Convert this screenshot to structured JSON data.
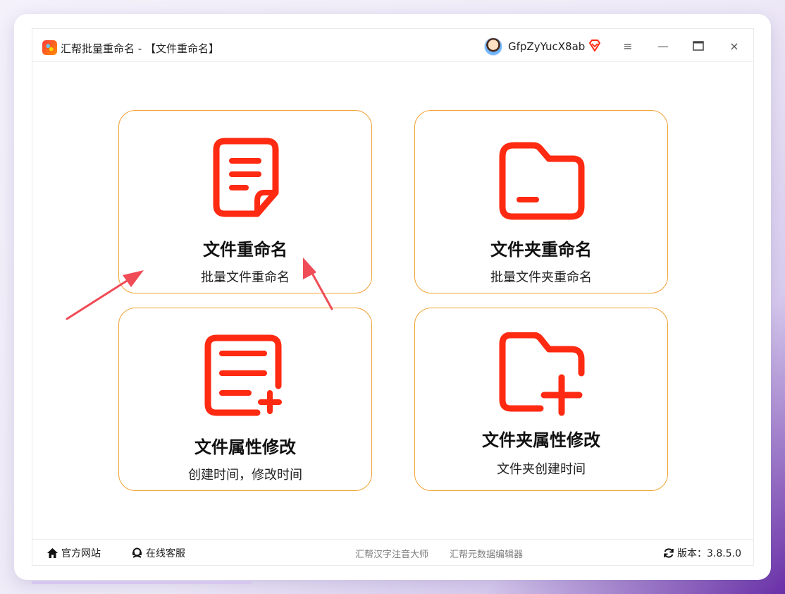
{
  "window": {
    "title": "汇帮批量重命名 - 【文件重命名】",
    "username": "GfpZyYucX8ab",
    "controls": {
      "menu": "≡",
      "minimize": "—",
      "maximize": "□",
      "close": "×"
    }
  },
  "cards": [
    {
      "title": "文件重命名",
      "subtitle": "批量文件重命名",
      "icon": "document-icon"
    },
    {
      "title": "文件夹重命名",
      "subtitle": "批量文件夹重命名",
      "icon": "folder-icon"
    },
    {
      "title": "文件属性修改",
      "subtitle": "创建时间，修改时间",
      "icon": "document-add-icon"
    },
    {
      "title": "文件夹属性修改",
      "subtitle": "文件夹创建时间",
      "icon": "folder-add-icon"
    }
  ],
  "footer": {
    "website": "官方网站",
    "support": "在线客服",
    "link1": "汇帮汉字注音大师",
    "link2": "汇帮元数据编辑器",
    "version": "版本：3.8.5.0"
  },
  "colors": {
    "accent_red": "#ff2a12",
    "card_border": "#f0a233",
    "annotation_arrow": "#ef4c57"
  }
}
